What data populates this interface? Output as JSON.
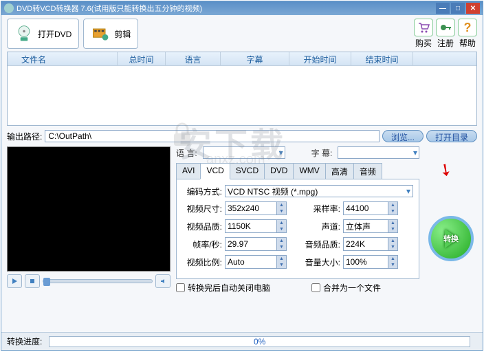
{
  "window": {
    "title": "DVD转VCD转换器 7.6(试用版只能转换出五分钟的视频)"
  },
  "toolbar": {
    "open_dvd": "打开DVD",
    "edit": "剪辑"
  },
  "rightbar": {
    "buy": "购买",
    "register": "注册",
    "help": "帮助"
  },
  "filelist": {
    "cols": {
      "name": "文件名",
      "total": "总时间",
      "lang": "语言",
      "subtitle": "字幕",
      "start": "开始时间",
      "end": "结束时间"
    }
  },
  "path": {
    "label": "输出路径:",
    "value": "C:\\OutPath\\",
    "browse": "浏览...",
    "open_dir": "打开目录"
  },
  "lang_row": {
    "lang_label": "语 言:",
    "sub_label": "字 幕:"
  },
  "tabs": {
    "avi": "AVI",
    "vcd": "VCD",
    "svcd": "SVCD",
    "dvd": "DVD",
    "wmv": "WMV",
    "hd": "高清",
    "audio": "音频"
  },
  "form": {
    "encode_label": "编码方式:",
    "encode_value": "VCD NTSC 视频 (*.mpg)",
    "size_label": "视频尺寸:",
    "size_value": "352x240",
    "sample_label": "采样率:",
    "sample_value": "44100",
    "vq_label": "视频品质:",
    "vq_value": "1150K",
    "channel_label": "声道:",
    "channel_value": "立体声",
    "fps_label": "帧率/秒:",
    "fps_value": "29.97",
    "aq_label": "音频品质:",
    "aq_value": "224K",
    "ratio_label": "视频比例:",
    "ratio_value": "Auto",
    "vol_label": "音量大小:",
    "vol_value": "100%"
  },
  "checks": {
    "shutdown": "转换完后自动关闭电脑",
    "merge": "合并为一个文件"
  },
  "convert": {
    "label": "转换"
  },
  "progress": {
    "label": "转换进度:",
    "value": "0%"
  },
  "watermark": {
    "text": "安下载",
    "sub": "anxz.com"
  }
}
